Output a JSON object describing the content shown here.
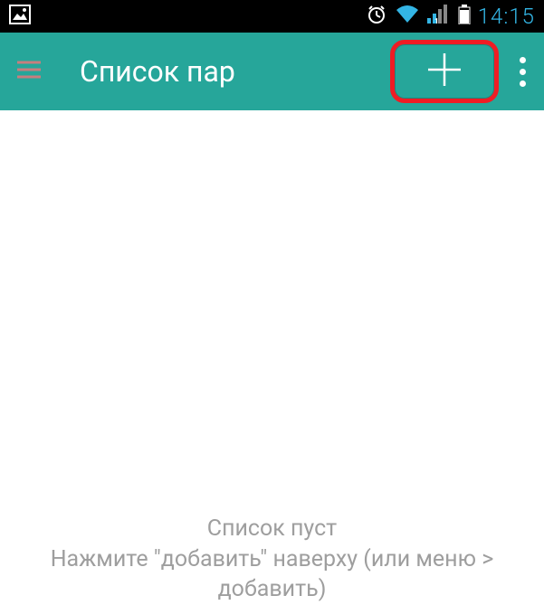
{
  "status_bar": {
    "time": "14:15"
  },
  "app_bar": {
    "title": "Список пар"
  },
  "content": {
    "empty_line1": "Список пуст",
    "empty_line2": "Нажмите \"добавить\" наверху (или меню > добавить)"
  },
  "colors": {
    "accent": "#26a69a",
    "highlight": "#ef1c24",
    "status_clock": "#33b5e5"
  }
}
